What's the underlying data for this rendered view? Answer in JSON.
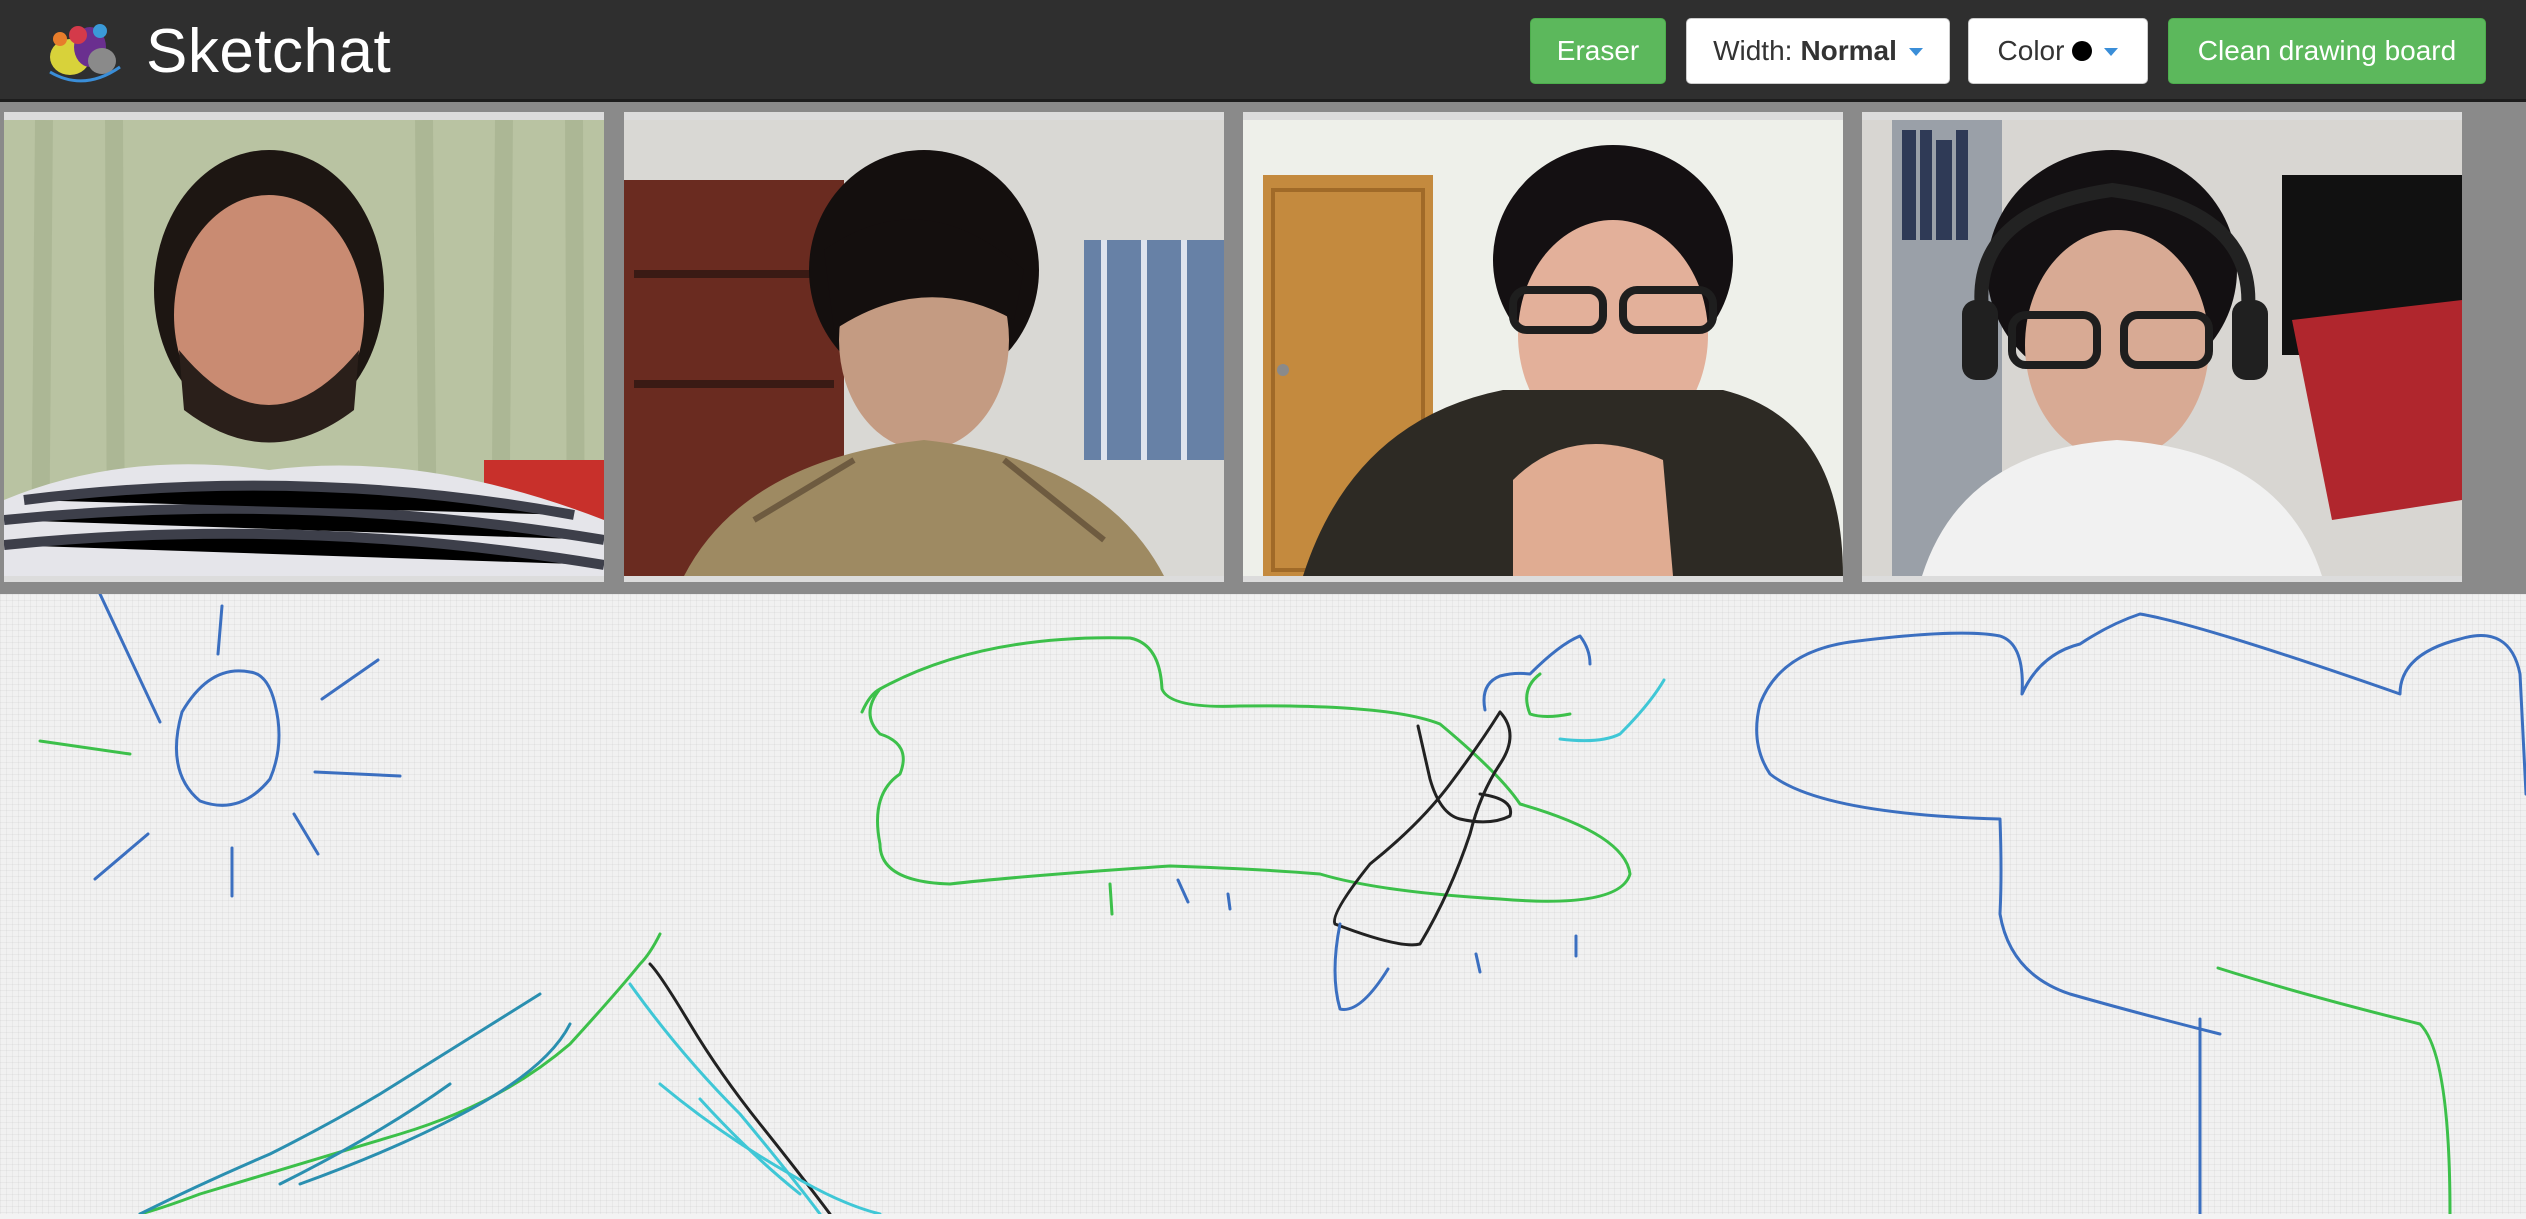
{
  "app": {
    "name": "Sketchat",
    "logo_icon": "paint-splash-logo-icon"
  },
  "toolbar": {
    "eraser_label": "Eraser",
    "width_label": "Width:",
    "width_value": "Normal",
    "color_label": "Color",
    "color_value": "#000000",
    "clean_label": "Clean drawing board"
  },
  "colors": {
    "navbar": "#2f2f2f",
    "button_green": "#5cb85c",
    "caret_blue": "#3a8ed8",
    "stroke_blue": "#3b6fc0",
    "stroke_green": "#3cc04a",
    "stroke_black": "#222222",
    "stroke_cyan": "#3fc7d6"
  },
  "video_feeds": [
    {
      "id": "participant-1"
    },
    {
      "id": "participant-2"
    },
    {
      "id": "participant-3"
    },
    {
      "id": "participant-4"
    }
  ]
}
